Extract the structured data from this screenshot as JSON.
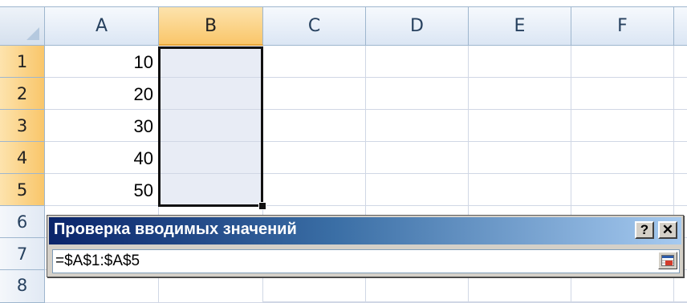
{
  "columns": [
    "A",
    "B",
    "C",
    "D",
    "E",
    "F"
  ],
  "rows": [
    "1",
    "2",
    "3",
    "4",
    "5",
    "6",
    "7",
    "8"
  ],
  "cells": {
    "A1": "10",
    "A2": "20",
    "A3": "30",
    "A4": "40",
    "A5": "50"
  },
  "selection": {
    "range": "B1:B5",
    "column": "B"
  },
  "dialog": {
    "title": "Проверка вводимых значений",
    "help_label": "?",
    "close_label": "✕",
    "reference_value": "=$A$1:$A$5",
    "collapse_icon": "range-expand-icon"
  },
  "colors": {
    "selected_header": "#f9c66a",
    "title_bar_start": "#0a246a",
    "title_bar_end": "#a6caf0",
    "selection_fill": "#e8ecf5"
  }
}
